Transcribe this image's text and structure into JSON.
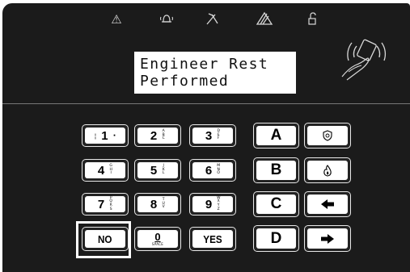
{
  "status_icons": [
    {
      "name": "warning-triangle-icon",
      "glyph": "⚠"
    },
    {
      "name": "bell-icon",
      "glyph": "🕭"
    },
    {
      "name": "antenna-icon",
      "glyph": "✕"
    },
    {
      "name": "tamper-icon",
      "glyph": "⚠"
    },
    {
      "name": "unlocked-padlock-icon",
      "glyph": "🔓"
    }
  ],
  "display": {
    "line1": "Engineer Rest",
    "line2": "Performed"
  },
  "proximity_icon": "proximity-tag-icon",
  "keys": {
    "k1": {
      "main": "1",
      "sub": "",
      "left_mark": "¦",
      "right_mark": "·"
    },
    "k2": {
      "main": "2",
      "sub": "ABC"
    },
    "k3": {
      "main": "3",
      "sub": "DEF"
    },
    "k4": {
      "main": "4",
      "sub": "GHI"
    },
    "k5": {
      "main": "5",
      "sub": "JKL"
    },
    "k6": {
      "main": "6",
      "sub": "MNO"
    },
    "k7": {
      "main": "7",
      "sub": "PQRS"
    },
    "k8": {
      "main": "8",
      "sub": "TUV"
    },
    "k9": {
      "main": "9",
      "sub": "WXYZ"
    },
    "no": {
      "label": "NO"
    },
    "k0": {
      "main": "0",
      "sub": "SPACE"
    },
    "yes": {
      "label": "YES"
    },
    "a": {
      "label": "A"
    },
    "b": {
      "label": "B"
    },
    "c": {
      "label": "C"
    },
    "d": {
      "label": "D"
    },
    "police": {
      "icon": "police-shield-icon",
      "glyph": "⛉"
    },
    "fire": {
      "icon": "fire-icon",
      "glyph": "♨"
    },
    "left": {
      "icon": "arrow-left-icon",
      "glyph": "◀"
    },
    "right": {
      "icon": "arrow-right-icon",
      "glyph": "▶"
    }
  },
  "colors": {
    "panel": "#1b1b1b",
    "key_face": "#ffffff",
    "highlight": "#ffffff"
  }
}
